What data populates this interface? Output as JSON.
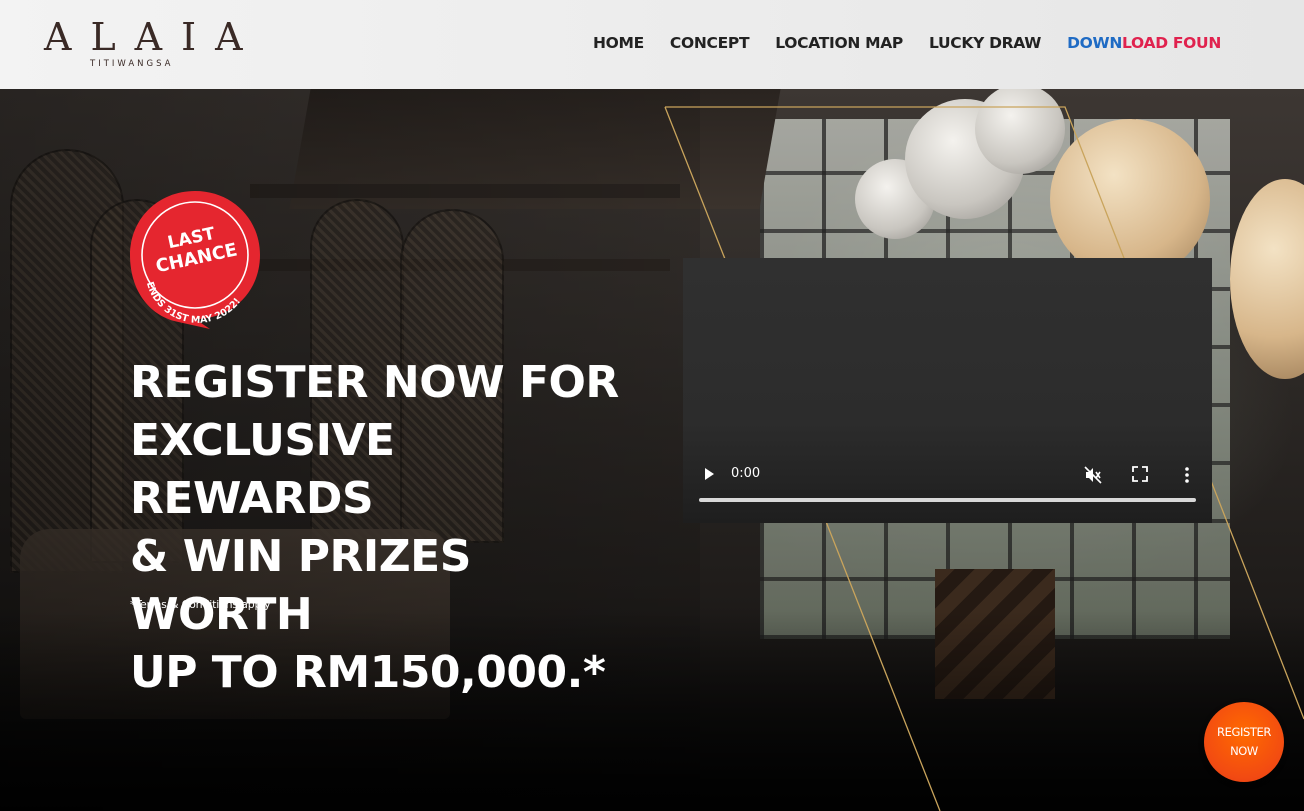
{
  "header": {
    "logo_title": "ALAIA",
    "logo_subtitle": "TITIWANGSA",
    "nav": {
      "home": "HOME",
      "concept": "CONCEPT",
      "location_map": "LOCATION MAP",
      "lucky_draw": "LUCKY DRAW",
      "download_part1": "DOWN",
      "download_part2": "LOAD FOUN"
    }
  },
  "badge": {
    "line1": "LAST",
    "line2": "CHANCE",
    "ends_text": "ENDS 31ST MAY 2022!",
    "color": "#e5262f"
  },
  "hero": {
    "headline_lines": [
      "REGISTER NOW FOR",
      "EXCLUSIVE REWARDS",
      "& WIN PRIZES WORTH",
      "UP TO RM150,000.*"
    ],
    "terms": "*Terms & Conditions apply"
  },
  "video": {
    "current_time": "0:00",
    "progress": 0,
    "play_icon": "play-icon",
    "mute_icon": "muted-icon",
    "fullscreen_icon": "fullscreen-icon",
    "more_icon": "more-vertical-icon"
  },
  "register_button": {
    "line1": "REGISTER",
    "line2": "NOW",
    "color": "#f24a12"
  },
  "colors": {
    "gold_accent": "#c9a45c",
    "download_blue": "#1f6bc4",
    "download_red": "#e0224e"
  }
}
